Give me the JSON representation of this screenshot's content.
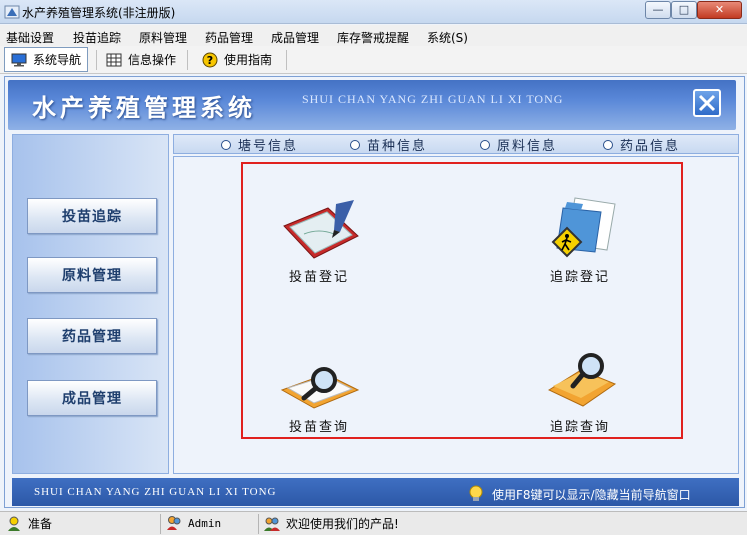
{
  "window": {
    "title": "水产养殖管理系统(非注册版)",
    "min_label": "—",
    "max_label": "□",
    "close_label": "✕"
  },
  "menu": [
    "基础设置",
    "投苗追踪",
    "原料管理",
    "药品管理",
    "成品管理",
    "库存警戒提醒",
    "系统(S)"
  ],
  "toolbar": {
    "items": [
      {
        "label": "系统导航",
        "icon": "monitor-icon"
      },
      {
        "label": "信息操作",
        "icon": "grid-icon"
      },
      {
        "label": "使用指南",
        "icon": "help-icon"
      }
    ]
  },
  "banner": {
    "title": "水产养殖管理系统",
    "subtitle": "SHUI CHAN YANG ZHI GUAN LI XI TONG"
  },
  "leftnav": [
    "投苗追踪",
    "原料管理",
    "药品管理",
    "成品管理"
  ],
  "radios": [
    "塘号信息",
    "苗种信息",
    "原料信息",
    "药品信息"
  ],
  "features": {
    "seed_register": "投苗登记",
    "track_register": "追踪登记",
    "seed_query": "投苗查询",
    "track_query": "追踪查询"
  },
  "footer": {
    "english": "SHUI CHAN YANG ZHI GUAN LI XI TONG",
    "tip": "使用F8键可以显示/隐藏当前导航窗口"
  },
  "status": {
    "ready": "准备",
    "user": "Admin",
    "welcome": "欢迎使用我们的产品!"
  },
  "colors": {
    "banner": "#4472c4",
    "highlight_box": "#e0201e",
    "footer": "#2c58a7"
  }
}
